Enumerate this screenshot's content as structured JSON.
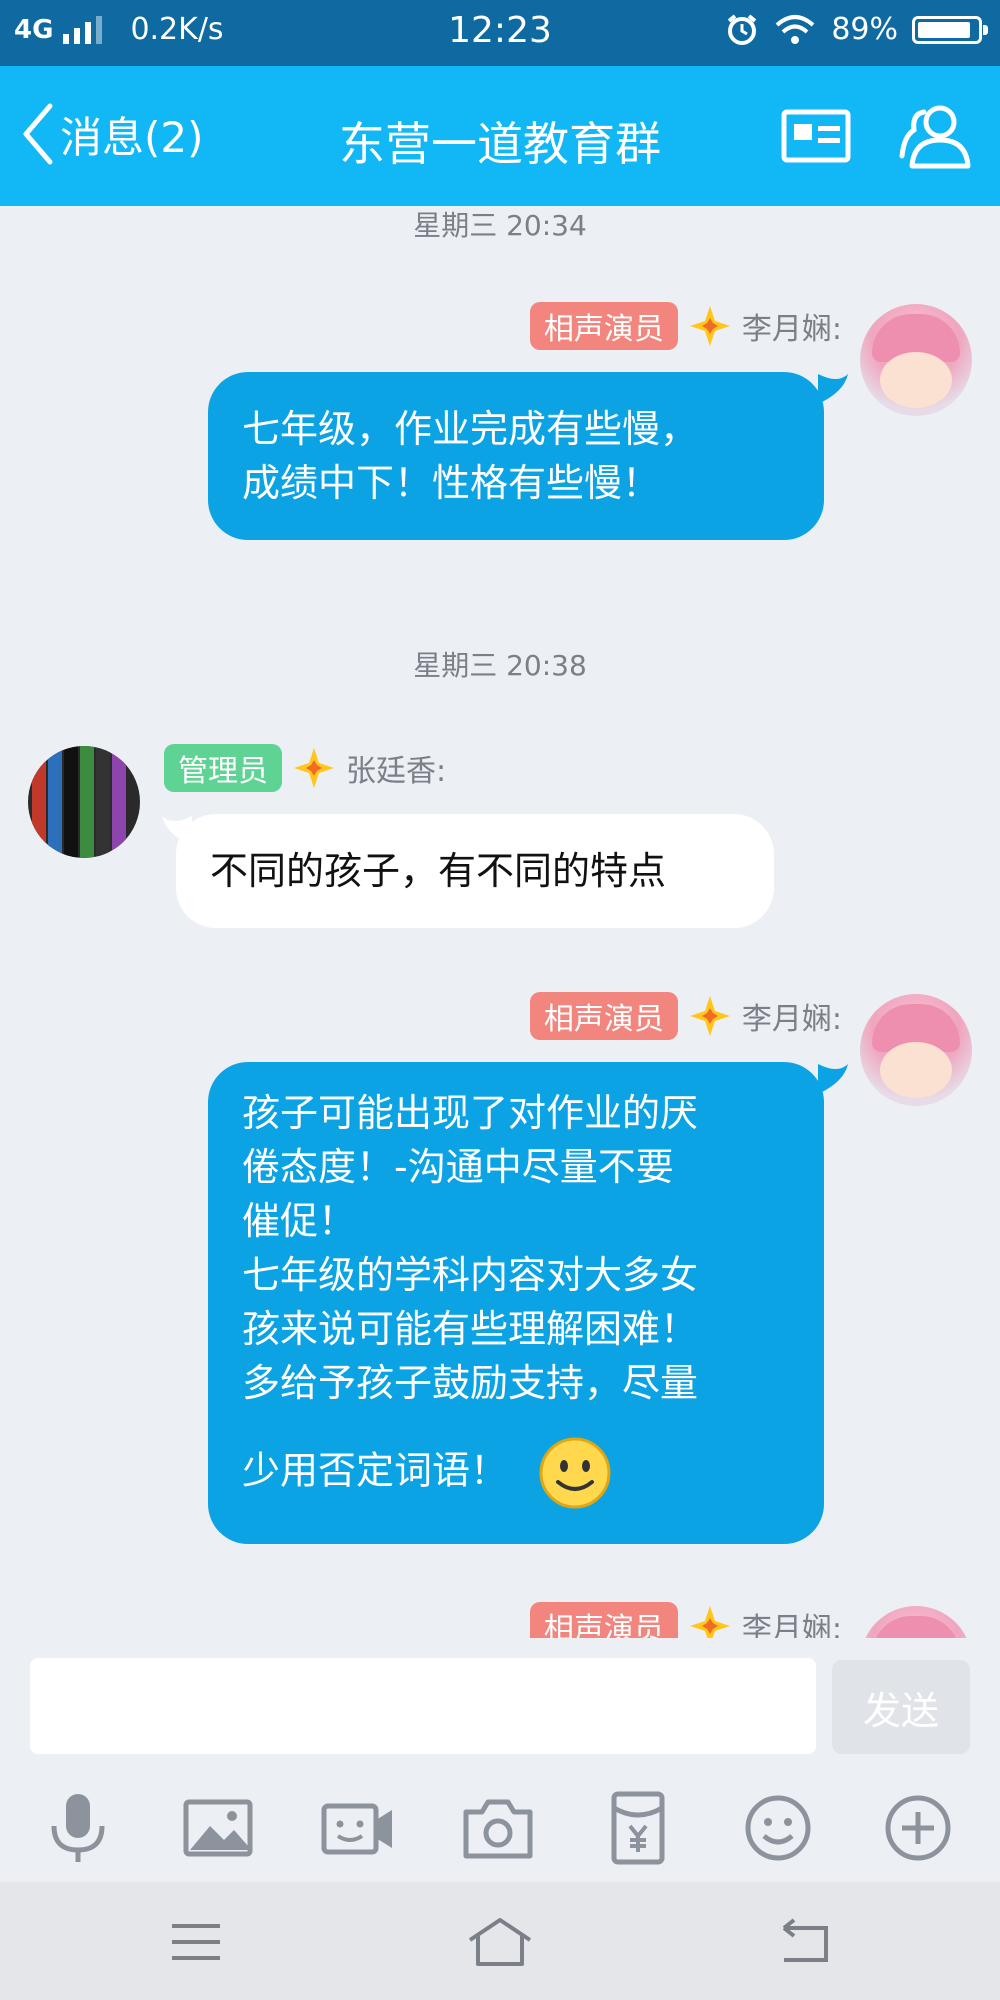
{
  "status_bar": {
    "network": "4G",
    "speed": "0.2K/s",
    "time": "12:23",
    "battery_percent": "89%",
    "battery_level": 0.89,
    "icons": [
      "signal-icon",
      "alarm-icon",
      "wifi-icon",
      "battery-icon"
    ]
  },
  "title_bar": {
    "back_label": "消息(2)",
    "title": "东营一道教育群",
    "icons": [
      "back-chevron-icon",
      "profile-card-icon",
      "group-members-icon"
    ],
    "color": "#12b7f5"
  },
  "chat": {
    "timestamps": [
      "星期三 20:34",
      "星期三 20:38"
    ],
    "messages": [
      {
        "badge": "相声演员",
        "sender": "李月娴:",
        "lines": [
          "七年级，作业完成有些慢，",
          "成绩中下！性格有些慢！"
        ]
      },
      {
        "badge": "管理员",
        "sender": "张廷香:",
        "lines": [
          "不同的孩子，有不同的特点"
        ]
      },
      {
        "badge": "相声演员",
        "sender": "李月娴:",
        "lines": [
          "孩子可能出现了对作业的厌",
          "倦态度！-沟通中尽量不要",
          "催促！",
          "七年级的学科内容对大多女",
          "孩来说可能有些理解困难！",
          "多给予孩子鼓励支持，尽量",
          "少用否定词语！"
        ]
      },
      {
        "badge": "相声演员",
        "sender": "李月娴:",
        "lines": []
      }
    ],
    "colors": {
      "bubble_out": "#0ca3e4",
      "bubble_in": "#ffffff",
      "badge_performer": "#f2857e",
      "badge_admin": "#5fd393"
    }
  },
  "input": {
    "value": "",
    "send_label": "发送",
    "tools": [
      "microphone-icon",
      "image-icon",
      "video-call-icon",
      "camera-icon",
      "red-envelope-icon",
      "emoji-icon",
      "plus-icon"
    ]
  },
  "nav_bar": {
    "icons": [
      "menu-icon",
      "home-icon",
      "back-icon"
    ]
  }
}
